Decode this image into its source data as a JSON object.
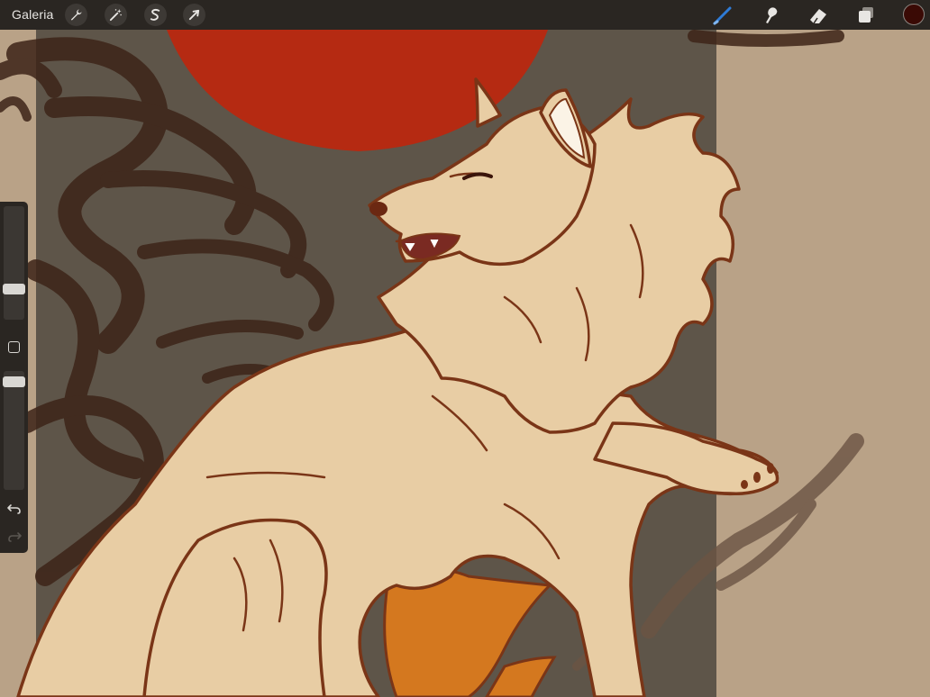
{
  "app": {
    "gallery_label": "Galeria"
  },
  "toolbar": {
    "left_tools": [
      {
        "name": "actions",
        "icon": "wrench-icon"
      },
      {
        "name": "adjustments",
        "icon": "magic-wand-icon"
      },
      {
        "name": "selection",
        "icon": "selection-s-icon"
      },
      {
        "name": "transform",
        "icon": "arrow-cursor-icon"
      }
    ],
    "right_tools": [
      {
        "name": "brush",
        "icon": "brush-icon",
        "active": true
      },
      {
        "name": "smudge",
        "icon": "smudge-icon",
        "active": false
      },
      {
        "name": "eraser",
        "icon": "eraser-icon",
        "active": false
      },
      {
        "name": "layers",
        "icon": "layers-icon",
        "active": false
      }
    ],
    "current_color": "#3a0a05",
    "active_color": "#2e7bd6"
  },
  "sidebar": {
    "brush_size": 0.28,
    "opacity": 1.0
  },
  "colors": {
    "background": "#b9a287",
    "panel": "#5e5549",
    "sun": "#b52a12",
    "wolf_fill": "#e8cda4",
    "outline": "#7a3517",
    "tail": "#d4781f",
    "smoke": "#3d2418"
  }
}
